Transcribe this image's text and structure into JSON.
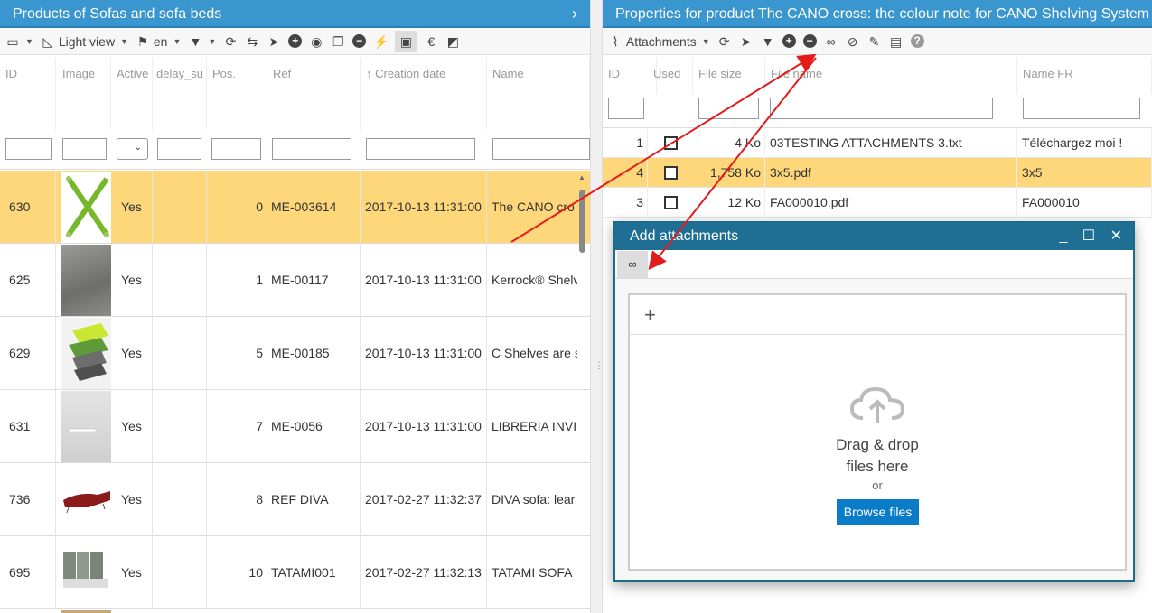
{
  "left": {
    "title": "Products of Sofas and sofa beds",
    "toolbar": {
      "view_label": "Light view",
      "lang_label": "en"
    },
    "columns": [
      "ID",
      "Image",
      "Active",
      "delay_su",
      "Pos.",
      "Ref",
      "Creation date",
      "Name"
    ],
    "sort_arrow": "↑",
    "rows": [
      {
        "id": "630",
        "active": "Yes",
        "pos": "0",
        "ref": "ME-003614",
        "date": "2017-10-13 11:31:00",
        "name": "The CANO cro"
      },
      {
        "id": "625",
        "active": "Yes",
        "pos": "1",
        "ref": "ME-00117",
        "date": "2017-10-13 11:31:00",
        "name": "Kerrock® Shelv"
      },
      {
        "id": "629",
        "active": "Yes",
        "pos": "5",
        "ref": "ME-00185",
        "date": "2017-10-13 11:31:00",
        "name": "C Shelves are s"
      },
      {
        "id": "631",
        "active": "Yes",
        "pos": "7",
        "ref": "ME-0056",
        "date": "2017-10-13 11:31:00",
        "name": "LIBRERIA INVI"
      },
      {
        "id": "736",
        "active": "Yes",
        "pos": "8",
        "ref": "REF DIVA",
        "date": "2017-02-27 11:32:37",
        "name": "DIVA sofa: lear"
      },
      {
        "id": "695",
        "active": "Yes",
        "pos": "10",
        "ref": "TATAMI001",
        "date": "2017-02-27 11:32:13",
        "name": "TATAMI SOFA"
      }
    ]
  },
  "right": {
    "title": "Properties for product The CANO cross: the colour note for CANO Shelving System",
    "toolbar": {
      "attachments_label": "Attachments"
    },
    "columns": [
      "ID",
      "Used",
      "File size",
      "File name",
      "Name FR"
    ],
    "rows": [
      {
        "id": "1",
        "size": "4 Ko",
        "file": "03TESTING ATTACHMENTS 3.txt",
        "name_fr": "Téléchargez moi !"
      },
      {
        "id": "4",
        "size": "1,758 Ko",
        "file": "3x5.pdf",
        "name_fr": "3x5"
      },
      {
        "id": "3",
        "size": "12 Ko",
        "file": "FA000010.pdf",
        "name_fr": "FA000010"
      }
    ]
  },
  "dialog": {
    "title": "Add attachments",
    "drag_line1": "Drag & drop",
    "drag_line2": "files here",
    "or": "or",
    "browse": "Browse files",
    "plus": "+"
  }
}
